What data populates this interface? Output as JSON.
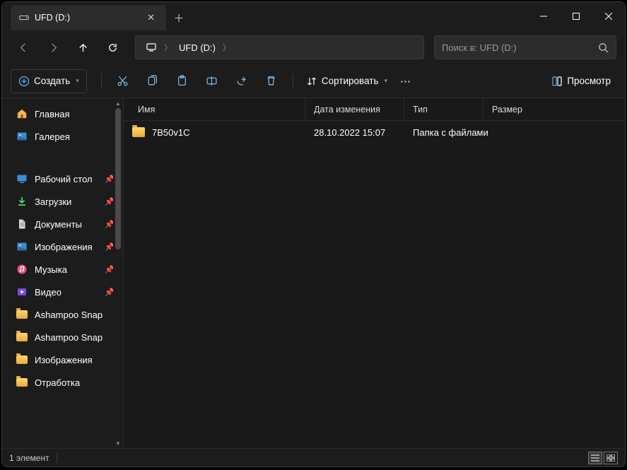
{
  "tab": {
    "title": "UFD (D:)"
  },
  "breadcrumb": {
    "location": "UFD (D:)"
  },
  "search": {
    "placeholder": "Поиск в: UFD (D:)"
  },
  "toolbar": {
    "create": "Создать",
    "sort": "Сортировать",
    "view": "Просмотр"
  },
  "columns": {
    "name": "Имя",
    "date": "Дата изменения",
    "type": "Тип",
    "size": "Размер"
  },
  "sidebar": {
    "main": [
      {
        "label": "Главная",
        "icon": "home"
      },
      {
        "label": "Галерея",
        "icon": "gallery"
      }
    ],
    "pinned": [
      {
        "label": "Рабочий стол",
        "icon": "desktop"
      },
      {
        "label": "Загрузки",
        "icon": "downloads"
      },
      {
        "label": "Документы",
        "icon": "documents"
      },
      {
        "label": "Изображения",
        "icon": "pictures"
      },
      {
        "label": "Музыка",
        "icon": "music"
      },
      {
        "label": "Видео",
        "icon": "video"
      },
      {
        "label": "Ashampoo Snap",
        "icon": "folder"
      },
      {
        "label": "Ashampoo Snap",
        "icon": "folder"
      },
      {
        "label": "Изображения",
        "icon": "folder"
      },
      {
        "label": "Отработка",
        "icon": "folder"
      }
    ]
  },
  "files": [
    {
      "name": "7B50v1C",
      "date": "28.10.2022 15:07",
      "type": "Папка с файлами",
      "size": ""
    }
  ],
  "status": {
    "count": "1 элемент"
  }
}
